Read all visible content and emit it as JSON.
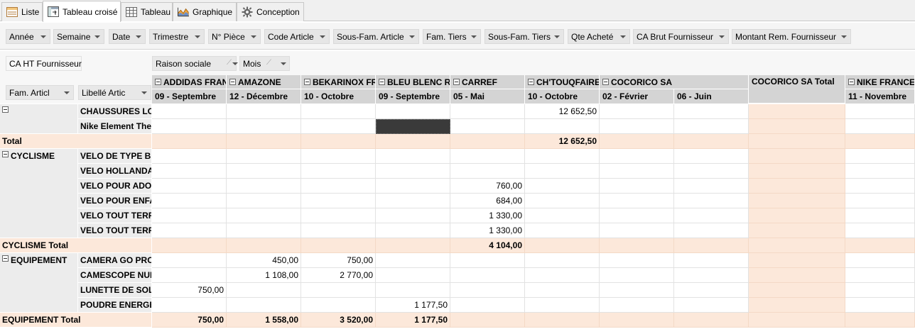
{
  "tabs": [
    {
      "label": "Liste",
      "icon": "list-icon",
      "active": false
    },
    {
      "label": "Tableau croisé",
      "icon": "pivot-icon",
      "active": true
    },
    {
      "label": "Tableau",
      "icon": "table-icon",
      "active": false
    },
    {
      "label": "Graphique",
      "icon": "chart-icon",
      "active": false
    },
    {
      "label": "Conception",
      "icon": "gear-icon",
      "active": false
    }
  ],
  "filters": [
    "Année",
    "Semaine",
    "Date",
    "Trimestre",
    "N° Pièce",
    "Code Article",
    "Sous-Fam. Article",
    "Fam. Tiers",
    "Sous-Fam. Tiers",
    "Qte Acheté",
    "CA Brut Fournisseur",
    "Montant Rem. Fournisseur"
  ],
  "data_field": "CA HT Fournisseur",
  "column_fields": [
    "Raison sociale",
    "Mois"
  ],
  "row_fields": [
    "Fam. Articl",
    "Libellé Artic"
  ],
  "columns": [
    {
      "group": "ADDIDAS FRANCE",
      "month": "09 - Septembre"
    },
    {
      "group": "AMAZONE",
      "month": "12 - Décembre"
    },
    {
      "group": "BEKARINOX FRANCE",
      "month": "10 - Octobre"
    },
    {
      "group": "BLEU BLENC ROUGE",
      "month": "09 - Septembre"
    },
    {
      "group": "CARREF",
      "month": "05 - Mai"
    },
    {
      "group": "CH'TOUQFAIRE",
      "month": "10 - Octobre"
    },
    {
      "group": "COCORICO SA",
      "month": "02 - Février"
    },
    {
      "group": "",
      "month": "06 - Juin"
    },
    {
      "group": "COCORICO SA Total",
      "month": ""
    },
    {
      "group": "NIKE FRANCE",
      "month": "11 - Novembre"
    }
  ],
  "rows": [
    {
      "family": "",
      "label": "CHAUSSURES LOISIRS",
      "values": [
        "",
        "",
        "",
        "",
        "",
        "12 652,50",
        "",
        "",
        "",
        ""
      ],
      "collapsible": true
    },
    {
      "family": "",
      "label": "Nike Element The",
      "values": [
        "",
        "",
        "",
        "",
        "",
        "",
        "",
        "",
        "",
        ""
      ]
    },
    {
      "family": "Total",
      "label": "",
      "total": true,
      "values": [
        "",
        "",
        "",
        "",
        "",
        "12 652,50",
        "",
        "",
        "",
        ""
      ]
    },
    {
      "family": "CYCLISME",
      "label": "VELO DE TYPE BMX",
      "values": [
        "",
        "",
        "",
        "",
        "",
        "",
        "",
        "",
        "",
        ""
      ],
      "collapsible": true
    },
    {
      "family": "",
      "label": "VELO HOLLANDAIS",
      "values": [
        "",
        "",
        "",
        "",
        "",
        "",
        "",
        "",
        "",
        ""
      ]
    },
    {
      "family": "",
      "label": "VELO POUR ADO",
      "values": [
        "",
        "",
        "",
        "",
        "760,00",
        "",
        "",
        "",
        "",
        ""
      ]
    },
    {
      "family": "",
      "label": "VELO POUR ENFANT",
      "values": [
        "",
        "",
        "",
        "",
        "684,00",
        "",
        "",
        "",
        "",
        ""
      ]
    },
    {
      "family": "",
      "label": "VELO TOUT TERRAIN",
      "values": [
        "",
        "",
        "",
        "",
        "1 330,00",
        "",
        "",
        "",
        "",
        ""
      ]
    },
    {
      "family": "",
      "label": "VELO TOUT TERRAIN",
      "values": [
        "",
        "",
        "",
        "",
        "1 330,00",
        "",
        "",
        "",
        "",
        ""
      ]
    },
    {
      "family": "CYCLISME Total",
      "label": "",
      "total": true,
      "values": [
        "",
        "",
        "",
        "",
        "4 104,00",
        "",
        "",
        "",
        "",
        ""
      ]
    },
    {
      "family": "EQUIPEMENT",
      "label": "CAMERA GO PRO",
      "values": [
        "",
        "450,00",
        "750,00",
        "",
        "",
        "",
        "",
        "",
        "",
        ""
      ],
      "collapsible": true
    },
    {
      "family": "",
      "label": "CAMESCOPE NUMERIQUE",
      "values": [
        "",
        "1 108,00",
        "2 770,00",
        "",
        "",
        "",
        "",
        "",
        "",
        ""
      ]
    },
    {
      "family": "",
      "label": "LUNETTE DE SOLEIL",
      "values": [
        "750,00",
        "",
        "",
        "",
        "",
        "",
        "",
        "",
        "",
        ""
      ]
    },
    {
      "family": "",
      "label": "POUDRE ENERGETIQUE",
      "values": [
        "",
        "",
        "",
        "1 177,50",
        "",
        "",
        "",
        "",
        "",
        ""
      ]
    },
    {
      "family": "EQUIPEMENT Total",
      "label": "",
      "total": true,
      "values": [
        "750,00",
        "1 558,00",
        "3 520,00",
        "1 177,50",
        "",
        "",
        "",
        "",
        "",
        ""
      ]
    }
  ]
}
